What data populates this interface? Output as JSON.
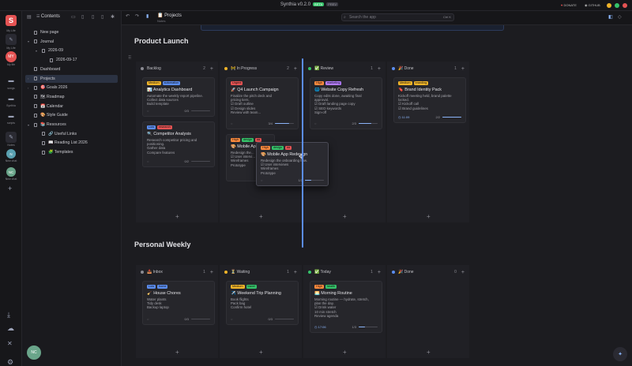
{
  "app": {
    "title": "Synthia v0.2.0",
    "beta": "BETA",
    "badge2": "PREV",
    "donate": "DONATE",
    "github": "GITHUB"
  },
  "sidebar_toolbar": {
    "contents": "Contents"
  },
  "rail": [
    {
      "label": "My Life",
      "icon": "S-logo"
    },
    {
      "label": "My life",
      "avatar": "MY"
    },
    {
      "label": "songs"
    },
    {
      "label": "Synthia"
    },
    {
      "label": "scripts"
    },
    {
      "label": "Notes"
    },
    {
      "label": "New chat",
      "avatar": "N"
    },
    {
      "label": "New chat",
      "avatar": "NC"
    }
  ],
  "tree": [
    {
      "label": "New page",
      "indent": 0,
      "caret": ""
    },
    {
      "label": "Journal",
      "indent": 0,
      "caret": "▾"
    },
    {
      "label": "2026-09",
      "indent": 1,
      "caret": "▾"
    },
    {
      "label": "2026-09-17",
      "indent": 2,
      "caret": ""
    },
    {
      "label": "Dashboard",
      "indent": 0,
      "caret": ""
    },
    {
      "label": "Projects",
      "indent": 0,
      "caret": "›",
      "active": true
    },
    {
      "label": "🎯 Goals 2026",
      "indent": 0,
      "caret": "›"
    },
    {
      "label": "🗺 Roadmap",
      "indent": 0,
      "caret": ""
    },
    {
      "label": "📅 Calendar",
      "indent": 0,
      "caret": ""
    },
    {
      "label": "🎨 Style Guide",
      "indent": 0,
      "caret": ""
    },
    {
      "label": "📚 Resources",
      "indent": 0,
      "caret": "▾"
    },
    {
      "label": "🔗 Useful Links",
      "indent": 1,
      "caret": ""
    },
    {
      "label": "📖 Reading List 2026",
      "indent": 1,
      "caret": ""
    },
    {
      "label": "🧩 Templates",
      "indent": 1,
      "caret": ""
    }
  ],
  "header": {
    "page": "Projects",
    "sub": "Notes",
    "search_placeholder": "Search the app",
    "shortcut": "Ctrl K"
  },
  "boards": [
    {
      "title": "Product Launch"
    },
    {
      "title": "Personal Weekly"
    }
  ],
  "launch_columns": [
    {
      "name": "Backlog",
      "count": "2",
      "color": "#8a8a92"
    },
    {
      "name": "🚧 In Progress",
      "count": "2",
      "color": "#f0b429"
    },
    {
      "name": "✅ Review",
      "count": "1",
      "color": "#35c36a"
    },
    {
      "name": "🎉 Done",
      "count": "1",
      "color": "#5b8def"
    }
  ],
  "weekly_columns": [
    {
      "name": "📥 Inbox",
      "count": "1",
      "color": "#8a8a92"
    },
    {
      "name": "⏳ Waiting",
      "count": "1",
      "color": "#f0b429"
    },
    {
      "name": "✅ Today",
      "count": "1",
      "color": "#35c36a"
    },
    {
      "name": "🎉 Done",
      "count": "0",
      "color": "#5b8def"
    }
  ],
  "cards": {
    "analytics": {
      "tags": [
        {
          "t": "Medium",
          "c": "#f0b429"
        },
        {
          "t": "automation",
          "c": "#5b8def"
        }
      ],
      "title": "📊 Analytics Dashboard",
      "body": "Automate the weekly report pipeline.\nCollect data sources\nBuild template",
      "progress": "0/3",
      "fill": 0
    },
    "competitor": {
      "tags": [
        {
          "t": "Low",
          "c": "#5b8def"
        },
        {
          "t": "research",
          "c": "#e55353"
        }
      ],
      "title": "🔍 Competitor Analysis",
      "body": "Research competitor pricing and\npositioning.\nGather data\nCompare features",
      "progress": "0/2",
      "fill": 0
    },
    "q4": {
      "tags": [
        {
          "t": "Urgent",
          "c": "#e55353"
        }
      ],
      "title": "🚀 Q4 Launch Campaign",
      "body": "Finalize the pitch deck and\npricing tiers.\n☑ Draft outline\n☑ Design slides\nReview with team...",
      "progress": "3/4",
      "fill": 0.75
    },
    "mobile_under": {
      "tags": [
        {
          "t": "High",
          "c": "#ff8a3d"
        },
        {
          "t": "design",
          "c": "#35c36a"
        },
        {
          "t": "dd",
          "c": "#e55353"
        }
      ],
      "title": "🎨 Mobile Ap...",
      "body": "Redesign the...\n☑ User intervi...\nWireframes\nPrototype",
      "progress": "",
      "fill": 0
    },
    "mobile_drag": {
      "tags": [
        {
          "t": "High",
          "c": "#ff8a3d"
        },
        {
          "t": "design",
          "c": "#35c36a"
        },
        {
          "t": "dd",
          "c": "#e55353"
        }
      ],
      "title": "🎨 Mobile App Redesign",
      "body": "Redesign the onboarding flow.\n☑ User interviews\nWireframes\nPrototype",
      "progress": "1/3",
      "fill": 0.33
    },
    "website": {
      "tags": [
        {
          "t": "High",
          "c": "#ff8a3d"
        },
        {
          "t": "marketing",
          "c": "#b47cff"
        }
      ],
      "title": "🌐 Website Copy Refresh",
      "body": "Copy edits done, awaiting final\napproval.\n☑ Draft landing page copy\n☑ SEO keywords\nSign-off",
      "progress": "2/3",
      "fill": 0.66
    },
    "brand": {
      "tags": [
        {
          "t": "Medium",
          "c": "#f0b429"
        },
        {
          "t": "branding",
          "c": "#f0b429"
        }
      ],
      "title": "🔖 Brand Identity Pack",
      "body": "Kickoff meeting held, brand palette\nlocked.\n☑ Kickoff call\n☑ Brand guidelines",
      "progress": "2/2",
      "fill": 1,
      "date": "11:09"
    },
    "chores": {
      "tags": [
        {
          "t": "Low",
          "c": "#5b8def"
        },
        {
          "t": "home",
          "c": "#5b8def"
        }
      ],
      "title": "🧹 House Chores",
      "body": "Water plants\nTidy desk\nBackup laptop",
      "progress": "0/3",
      "fill": 0
    },
    "trip": {
      "tags": [
        {
          "t": "Medium",
          "c": "#f0b429"
        },
        {
          "t": "travel",
          "c": "#35c36a"
        }
      ],
      "title": "✈️ Weekend Trip Planning",
      "body": "Book flights\nPack bag\nConfirm hotel",
      "progress": "0/3",
      "fill": 0
    },
    "routine": {
      "tags": [
        {
          "t": "High",
          "c": "#ff8a3d"
        },
        {
          "t": "health",
          "c": "#35c36a"
        }
      ],
      "title": "🌅 Morning Routine",
      "body": "Morning routine — hydrate, stretch,\nplan the day.\n☑ Drink water\n10 min stretch\nReview agenda",
      "progress": "1/3",
      "fill": 0.33,
      "date": "17:06"
    }
  },
  "user": {
    "avatar": "NC"
  },
  "colors": {
    "accent": "#8ab4f8",
    "bg": "#1c1c20"
  }
}
